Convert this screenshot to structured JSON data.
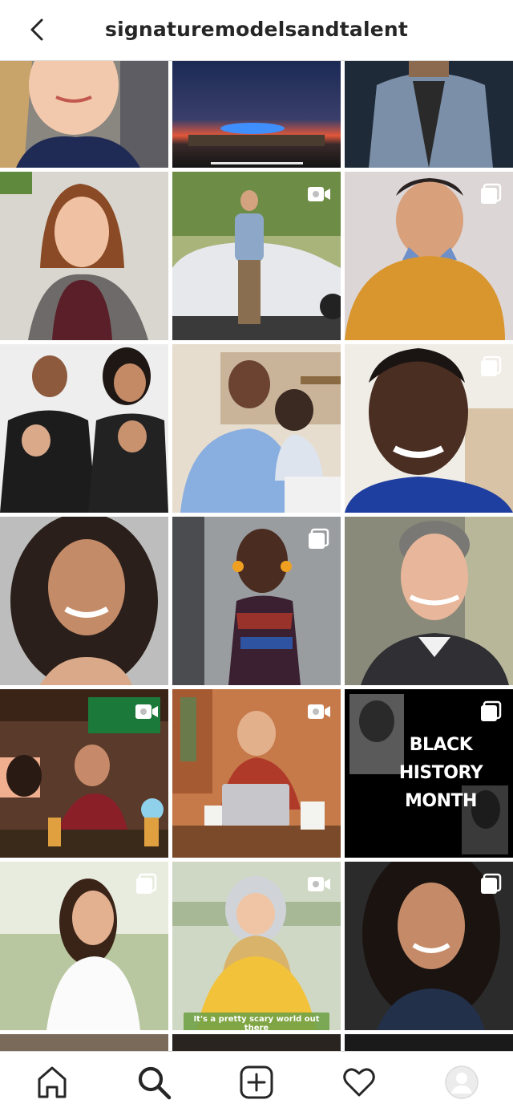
{
  "header": {
    "title": "signaturemodelsandtalent"
  },
  "grid": {
    "tiles": [
      {
        "name": "tile-girl-portrait",
        "badge": "none"
      },
      {
        "name": "tile-stadium-night",
        "badge": "none"
      },
      {
        "name": "tile-denim-jacket",
        "badge": "none"
      },
      {
        "name": "tile-man-long-hair",
        "badge": "none"
      },
      {
        "name": "tile-man-by-car",
        "badge": "video"
      },
      {
        "name": "tile-boy-sweater",
        "badge": "carousel"
      },
      {
        "name": "tile-family-photo",
        "badge": "none"
      },
      {
        "name": "tile-father-daughter",
        "badge": "none"
      },
      {
        "name": "tile-young-man-smile",
        "badge": "carousel"
      },
      {
        "name": "tile-woman-curly-hair",
        "badge": "none"
      },
      {
        "name": "tile-girl-african-dress",
        "badge": "carousel"
      },
      {
        "name": "tile-man-gray-hair",
        "badge": "none"
      },
      {
        "name": "tile-sports-bar",
        "badge": "video"
      },
      {
        "name": "tile-man-laptop",
        "badge": "video"
      },
      {
        "name": "tile-black-history-month",
        "badge": "carousel",
        "text": [
          "BLACK",
          "HISTORY",
          "MONTH"
        ]
      },
      {
        "name": "tile-woman-outdoor",
        "badge": "carousel"
      },
      {
        "name": "tile-child-helmet",
        "badge": "video",
        "caption": "It's a pretty scary world out there"
      },
      {
        "name": "tile-woman-curly-studio",
        "badge": "carousel"
      }
    ]
  },
  "nav": {
    "items": [
      {
        "name": "home-icon"
      },
      {
        "name": "search-icon",
        "active": true
      },
      {
        "name": "new-post-icon"
      },
      {
        "name": "activity-heart-icon"
      },
      {
        "name": "profile-avatar"
      }
    ]
  },
  "colors": {
    "text": "#262626",
    "border": "#dbdbdb",
    "background": "#ffffff"
  }
}
